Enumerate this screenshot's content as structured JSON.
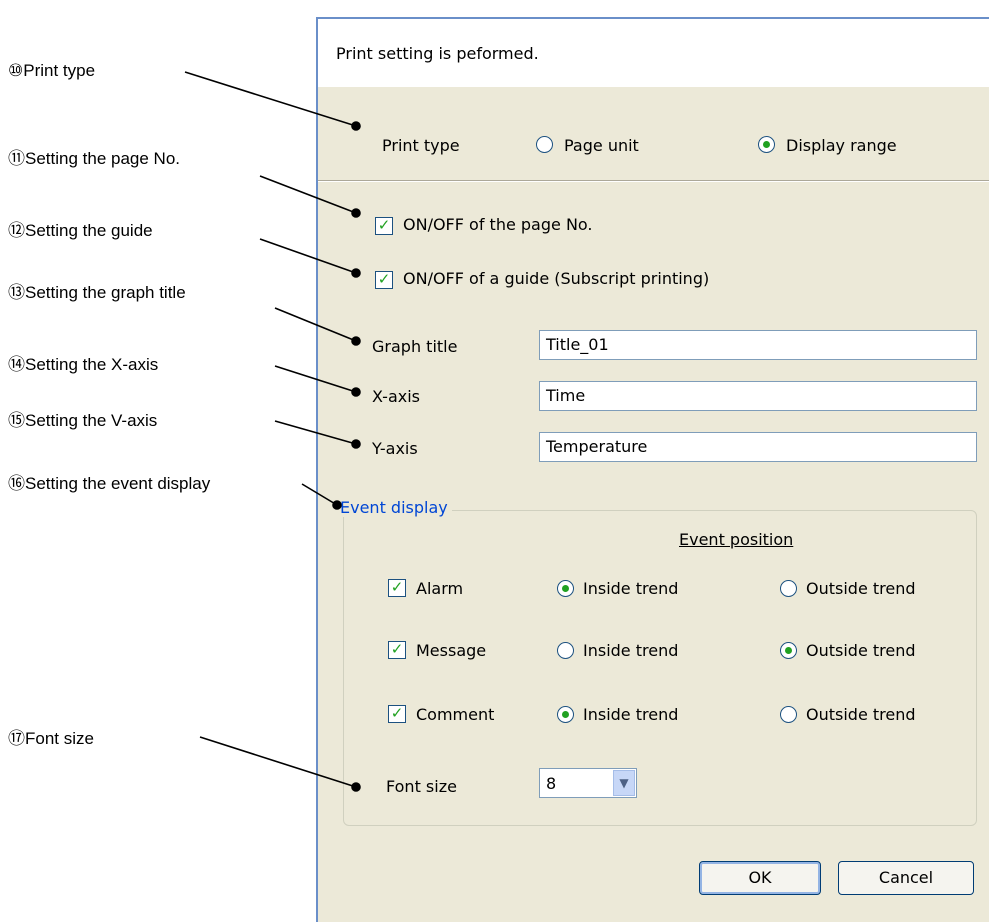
{
  "callouts": {
    "print_type": "⑩Print type",
    "page_no": "⑪Setting the page No.",
    "guide": "⑫Setting the guide",
    "graph_title": "⑬Setting the graph title",
    "x_axis": "⑭Setting the X-axis",
    "v_axis": "⑮Setting the V-axis",
    "event_display": "⑯Setting the event display",
    "font_size": "⑰Font size"
  },
  "dialog": {
    "message": "Print setting is peformed.",
    "print_type": {
      "label": "Print type",
      "options": [
        "Page unit",
        "Display range"
      ],
      "selected": "Display range"
    },
    "page_no_check": {
      "label": "ON/OFF of the page No.",
      "checked": true
    },
    "guide_check": {
      "label": "ON/OFF of a guide (Subscript printing)",
      "checked": true
    },
    "graph_title": {
      "label": "Graph title",
      "value": "Title_01"
    },
    "x_axis": {
      "label": "X-axis",
      "value": "Time"
    },
    "y_axis": {
      "label": "Y-axis",
      "value": "Temperature"
    },
    "event_display": {
      "legend": "Event display",
      "position_header": "Event position",
      "rows": [
        {
          "label": "Alarm",
          "checked": true,
          "inside": "Inside trend",
          "outside": "Outside trend",
          "selected": "inside"
        },
        {
          "label": "Message",
          "checked": true,
          "inside": "Inside trend",
          "outside": "Outside trend",
          "selected": "outside"
        },
        {
          "label": "Comment",
          "checked": true,
          "inside": "Inside trend",
          "outside": "Outside trend",
          "selected": "inside"
        }
      ]
    },
    "font_size": {
      "label": "Font size",
      "value": "8"
    },
    "buttons": {
      "ok": "OK",
      "cancel": "Cancel"
    }
  },
  "colors": {
    "dialog_bg": "#ece9d8",
    "accent": "#21a121",
    "border": "#6a8fc9",
    "legend": "#0046d5"
  }
}
